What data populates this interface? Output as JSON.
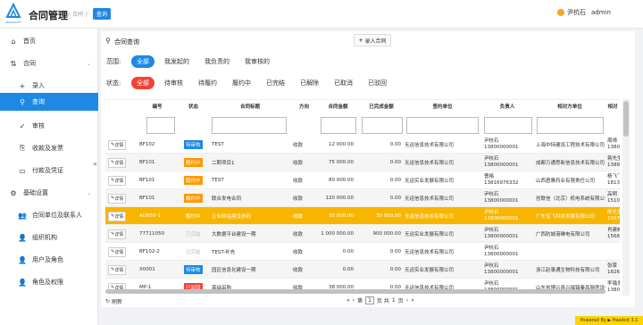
{
  "app": {
    "title": "合同管理",
    "logo_text": "SMARTSOFT"
  },
  "breadcrumb": {
    "parent": "合同",
    "current": "查询"
  },
  "user": {
    "name": "尹杭石",
    "role": "admin"
  },
  "sidebar": {
    "items": [
      {
        "label": "首页",
        "icon": "home-icon",
        "glyph": "⌂"
      },
      {
        "label": "合同",
        "icon": "contract-icon",
        "glyph": "⇅",
        "arrow": "⌄"
      },
      {
        "label": "录入",
        "icon": "plus-icon",
        "glyph": "+"
      },
      {
        "label": "查询",
        "icon": "search-icon",
        "glyph": "⚲"
      },
      {
        "label": "审核",
        "icon": "check-icon",
        "glyph": "✓"
      },
      {
        "label": "收款及发票",
        "icon": "receipt-icon",
        "glyph": "⎘"
      },
      {
        "label": "付款及凭证",
        "icon": "payment-icon",
        "glyph": "▭"
      },
      {
        "label": "基础设置",
        "icon": "settings-icon",
        "glyph": "⚙",
        "arrow": "⌄"
      },
      {
        "label": "合同单位及联系人",
        "icon": "contacts-icon",
        "glyph": "👥"
      },
      {
        "label": "组织机构",
        "icon": "org-icon",
        "glyph": "👤"
      },
      {
        "label": "用户及角色",
        "icon": "user-icon",
        "glyph": "👤"
      },
      {
        "label": "角色及权限",
        "icon": "role-icon",
        "glyph": "👤"
      }
    ],
    "collapse": "«"
  },
  "main": {
    "title": "合同查询",
    "add_label": "录入合同",
    "search_glyph": "⚲",
    "add_glyph": "+"
  },
  "filters": {
    "scope_label": "范围:",
    "scope": [
      "全部",
      "我发起的",
      "我负责的",
      "我审核的"
    ],
    "status_label": "状态:",
    "status": [
      "全部",
      "待审核",
      "待履约",
      "履约中",
      "已完结",
      "已解除",
      "已取消",
      "已驳回"
    ]
  },
  "table": {
    "headers": [
      "编号",
      "状态",
      "合同标题",
      "方向",
      "合同金额",
      "已完成金额",
      "签约单位",
      "负责人",
      "相对方单位",
      "相对"
    ],
    "detail_label": "详情",
    "rows": [
      {
        "no": "BF102",
        "status": "待审核",
        "badge": "blue",
        "title": "TEST",
        "dir": "收款",
        "amount": "12 000.00",
        "done": "0.00",
        "signer": "无运信息技术有限公司",
        "owner": [
          "尹杭石",
          "13800000001"
        ],
        "party": "上海中特建设工程技术有限公司",
        "contact": [
          "周靖",
          "1380"
        ]
      },
      {
        "no": "BF101",
        "status": "履约中",
        "badge": "orange",
        "title": "二期项目1",
        "dir": "收款",
        "amount": "75 000.00",
        "done": "0.00",
        "signer": "无运信息技术有限公司",
        "owner": [
          "尹杭石",
          "13800000001"
        ],
        "party": "成都万通思新信息技术有限公司",
        "contact": [
          "蒋先生",
          "1388"
        ]
      },
      {
        "no": "BF101",
        "status": "履约中",
        "badge": "orange",
        "title": "TEST",
        "dir": "收款",
        "amount": "80 000.00",
        "done": "0.00",
        "signer": "无运实业发展有限公司",
        "owner": [
          "曹格",
          "13816976332"
        ],
        "party": "山西君雅药业有限责任公司",
        "contact": [
          "杨飞飞",
          "1813"
        ]
      },
      {
        "no": "BF101",
        "status": "履约中",
        "badge": "orange",
        "title": "联合发电合同",
        "dir": "收款",
        "amount": "120 000.00",
        "done": "0.00",
        "signer": "无运信息技术有限公司",
        "owner": [
          "尹杭石",
          "13800000001"
        ],
        "party": "创联信（北京）机电系统有限公司",
        "contact": [
          "高明",
          "1510"
        ]
      },
      {
        "no": "AG850-1",
        "status": "履约中",
        "badge": "plain",
        "title": "企业网站建设协同",
        "dir": "收款",
        "amount": "30 000.00",
        "done": "30 000.00",
        "signer": "无运信息技术有限公司",
        "owner": [
          "尹杭石",
          "13800000001"
        ],
        "party": "广东宝飞科技发展有限公司",
        "contact": [
          "陈先生",
          "1567"
        ]
      },
      {
        "no": "77711050",
        "status": "已完结",
        "badge": "grey",
        "title": "大数据平台建设一期",
        "dir": "收款",
        "amount": "1 000 000.00",
        "done": "900 000.00",
        "signer": "无运实业发展有限公司",
        "owner": [
          "尹杭石",
          "13800000001"
        ],
        "party": "广西防城港琳电有限公司",
        "contact": [
          "肖建峰",
          "1566"
        ]
      },
      {
        "no": "BF102-2",
        "status": "已完结",
        "badge": "grey",
        "title": "TEST-补充",
        "dir": "收款",
        "amount": "0.00",
        "done": "0.00",
        "signer": "无运信息技术有限公司",
        "owner": [
          "尹杭石",
          "13800000001"
        ],
        "party": "",
        "contact": [
          "",
          ""
        ]
      },
      {
        "no": "X0001",
        "status": "待审核",
        "badge": "blue",
        "title": "园区信息化建设一期",
        "dir": "收款",
        "amount": "0.00",
        "done": "0.00",
        "signer": "无运实业发展有限公司",
        "owner": [
          "尹杭石",
          "13800000001"
        ],
        "party": "浙江赵事通生物科技有限公司",
        "contact": [
          "张章",
          "1826"
        ]
      },
      {
        "no": "MP-1",
        "status": "已驳回",
        "badge": "red",
        "title": "基础采购",
        "dir": "收款",
        "amount": "38 000.00",
        "done": "0.00",
        "signer": "无运信息技术有限公司",
        "owner": [
          "尹杭石",
          "13800000001"
        ],
        "party": "山东省博兴县兴福镇秦昌厨房设备制造",
        "contact": [
          "李璐发",
          "1380"
        ]
      }
    ]
  },
  "footer": {
    "refresh": "刷新",
    "page_prefix": "第",
    "page": "1",
    "page_suffix": "页 共",
    "total": "1",
    "total_suffix": "页",
    "prev": "‹",
    "next": "›",
    "first": "«",
    "last": "»"
  },
  "powered": "Powered By ▶ Hasdoit 3.1",
  "colors": {
    "accent": "#1e88e5",
    "highlight": "#f8b500",
    "danger": "#f44336",
    "warning": "#ff9800"
  }
}
